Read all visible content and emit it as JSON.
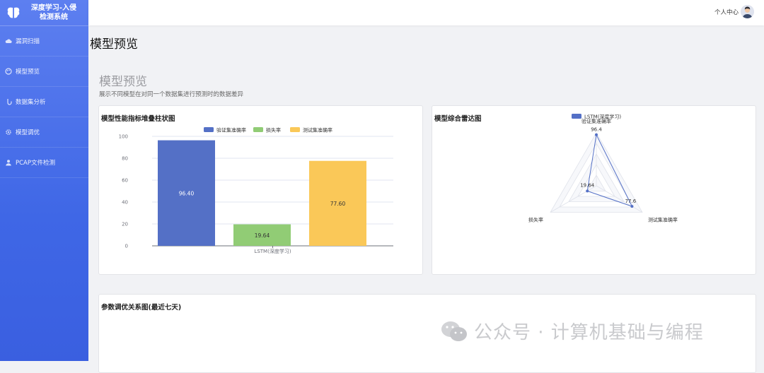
{
  "app": {
    "title_line1": "深度学习-入侵",
    "title_line2": "检测系统"
  },
  "sidebar": {
    "items": [
      {
        "label": "漏洞扫描",
        "icon": "cloud-icon"
      },
      {
        "label": "模型预览",
        "icon": "palette-icon"
      },
      {
        "label": "数据集分析",
        "icon": "hand-icon"
      },
      {
        "label": "模型调优",
        "icon": "gear-icon"
      },
      {
        "label": "PCAP文件检测",
        "icon": "user-icon"
      }
    ]
  },
  "header": {
    "user_center": "个人中心"
  },
  "page": {
    "title": "模型预览",
    "section_title": "模型预览",
    "section_desc": "展示不同模型在对同一个数据集进行预测时的数据差异"
  },
  "bar_card": {
    "title": "模型性能指标堆叠柱状图"
  },
  "radar_card": {
    "title": "模型综合雷达图"
  },
  "bottom_card": {
    "title": "参数调优关系图(最近七天)"
  },
  "watermark": {
    "text": "公众号 · 计算机基础与编程"
  },
  "colors": {
    "blue": "#5470c6",
    "green": "#91cc75",
    "yellow": "#fac858",
    "sidebar": "#4a6fe8"
  },
  "chart_data": [
    {
      "type": "bar",
      "categories": [
        "LSTM(深度学习)"
      ],
      "series": [
        {
          "name": "验证集准确率",
          "values": [
            96.4
          ],
          "label": "96.40"
        },
        {
          "name": "损失率",
          "values": [
            19.64
          ],
          "label": "19.64"
        },
        {
          "name": "测试集准确率",
          "values": [
            77.6
          ],
          "label": "77.60"
        }
      ],
      "ylim": [
        0,
        100
      ],
      "yticks": [
        "0",
        "20",
        "40",
        "60",
        "80",
        "100"
      ],
      "legend": "top-center",
      "grid": true
    },
    {
      "type": "radar",
      "indicators": [
        "验证集准确率",
        "测试集准确率",
        "损失率"
      ],
      "series": [
        {
          "name": "LSTM(深度学习)",
          "values": [
            96.4,
            77.6,
            19.64
          ],
          "labels": [
            "96.4",
            "77.6",
            "19.64"
          ]
        }
      ],
      "max": 100,
      "legend": "top-center"
    }
  ]
}
